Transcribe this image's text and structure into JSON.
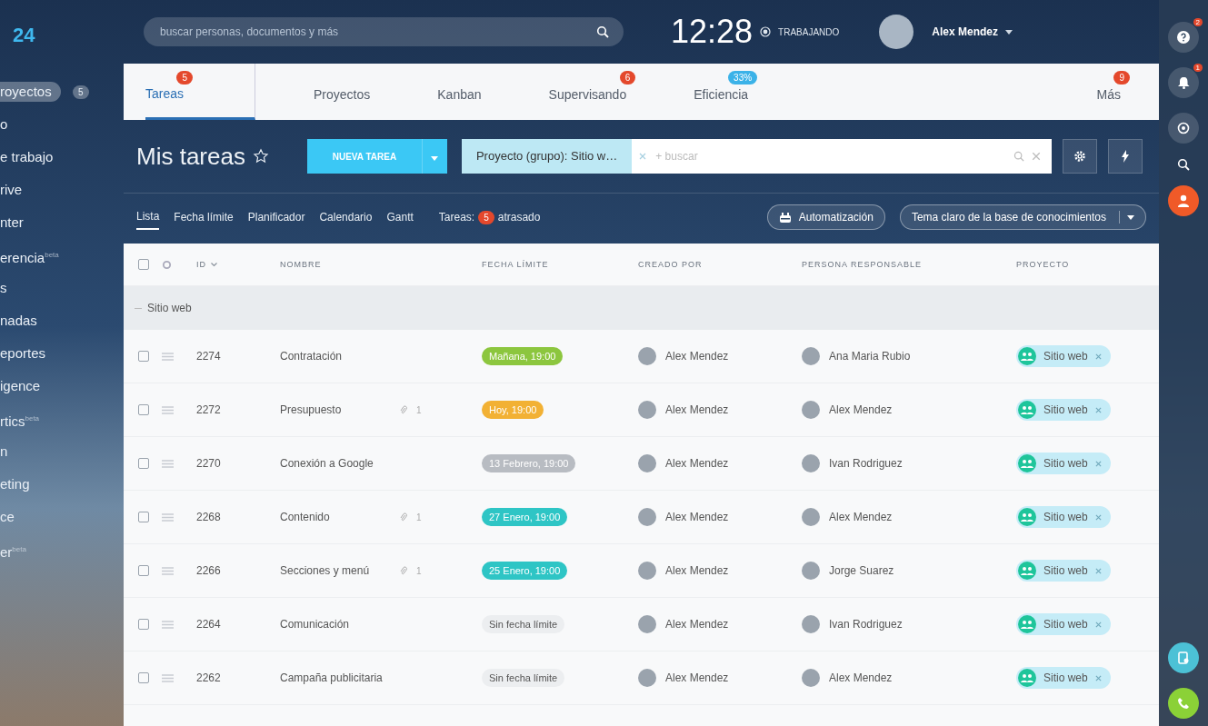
{
  "sidebar": {
    "logo": "24",
    "items": [
      {
        "label": "royectos",
        "badge": "5",
        "selected": true
      },
      {
        "label": "o",
        "selected": false
      },
      {
        "label": "e trabajo",
        "selected": false
      },
      {
        "label": "rive",
        "selected": false
      },
      {
        "label": "nter",
        "selected": false
      },
      {
        "label": "erencia",
        "selected": false,
        "sup": "beta"
      },
      {
        "label": "s",
        "selected": false
      },
      {
        "label": "nadas",
        "selected": false
      },
      {
        "label": "eportes",
        "selected": false
      },
      {
        "label": "igence",
        "selected": false
      },
      {
        "label": "rtics",
        "selected": false,
        "sup": "beta"
      },
      {
        "label": "n",
        "selected": false
      },
      {
        "label": "eting",
        "selected": false
      },
      {
        "label": "ce",
        "selected": false
      },
      {
        "label": "er",
        "selected": false,
        "sup": "beta"
      }
    ]
  },
  "topbar": {
    "search": {
      "placeholder": "buscar personas, documentos y más"
    },
    "time": "12:28",
    "status": "TRABAJANDO",
    "user": "Alex Mendez"
  },
  "tabs": [
    {
      "label": "Tareas",
      "selected": true,
      "badge": {
        "text": "5",
        "color": "#e4482c"
      }
    },
    {
      "label": "Proyectos",
      "selected": false
    },
    {
      "label": "Kanban",
      "selected": false
    },
    {
      "label": "Supervisando",
      "selected": false,
      "badge": {
        "text": "6",
        "color": "#e4482c"
      }
    },
    {
      "label": "Eficiencia",
      "selected": false,
      "badge": {
        "text": "33%",
        "color": "#3bb2e8"
      }
    },
    {
      "label": "Más",
      "selected": false,
      "badge": {
        "text": "9",
        "color": "#e4482c"
      }
    }
  ],
  "toolbar": {
    "title": "Mis tareas",
    "new_button": "NUEVA TAREA",
    "filter_chip": "Proyecto (grupo): Sitio w…",
    "filter_placeholder": "+ buscar"
  },
  "views": [
    {
      "label": "Lista",
      "selected": true
    },
    {
      "label": "Fecha límite",
      "selected": false
    },
    {
      "label": "Planificador",
      "selected": false
    },
    {
      "label": "Calendario",
      "selected": false
    },
    {
      "label": "Gantt",
      "selected": false
    }
  ],
  "counter": {
    "label": "Tareas:",
    "count": "5",
    "suffix": "atrasado"
  },
  "automation_button": "Automatización",
  "theme_button": "Tema claro de la base de conocimientos",
  "table": {
    "columns": [
      "ID",
      "NOMBRE",
      "FECHA LÍMITE",
      "CREADO POR",
      "PERSONA RESPONSABLE",
      "PROYECTO"
    ],
    "all_checked": false,
    "group": "Sitio web",
    "rows": [
      {
        "checked": false,
        "id": "2274",
        "name": "Contratación",
        "due": {
          "text": "Mañana, 19:00",
          "kind": "date",
          "color": "#8cc63e"
        },
        "creator": "Alex Mendez",
        "responsible": "Ana Maria Rubio",
        "project": "Sitio web"
      },
      {
        "checked": false,
        "id": "2272",
        "name": "Presupuesto",
        "comments": "1",
        "due": {
          "text": "Hoy, 19:00",
          "kind": "date",
          "color": "#f2b134"
        },
        "creator": "Alex Mendez",
        "responsible": "Alex Mendez",
        "project": "Sitio web"
      },
      {
        "checked": false,
        "id": "2270",
        "name": "Conexión a Google",
        "due": {
          "text": "13 Febrero, 19:00",
          "kind": "date",
          "color": "#b8bcc2"
        },
        "creator": "Alex Mendez",
        "responsible": "Ivan Rodriguez",
        "project": "Sitio web"
      },
      {
        "checked": false,
        "id": "2268",
        "name": "Contenido",
        "comments": "1",
        "due": {
          "text": "27 Enero, 19:00",
          "kind": "date",
          "color": "#2ec5c5"
        },
        "creator": "Alex Mendez",
        "responsible": "Alex Mendez",
        "project": "Sitio web"
      },
      {
        "checked": false,
        "id": "2266",
        "name": "Secciones y menú",
        "comments": "1",
        "due": {
          "text": "25 Enero, 19:00",
          "kind": "date",
          "color": "#2ec5c5"
        },
        "creator": "Alex Mendez",
        "responsible": "Jorge Suarez",
        "project": "Sitio web"
      },
      {
        "checked": false,
        "id": "2264",
        "name": "Comunicación",
        "due": {
          "text": "Sin fecha límite",
          "kind": "none",
          "color": "#eceef0"
        },
        "creator": "Alex Mendez",
        "responsible": "Ivan Rodriguez",
        "project": "Sitio web"
      },
      {
        "checked": false,
        "id": "2262",
        "name": "Campaña publicitaria",
        "due": {
          "text": "Sin fecha límite",
          "kind": "none",
          "color": "#eceef0"
        },
        "creator": "Alex Mendez",
        "responsible": "Alex Mendez",
        "project": "Sitio web"
      }
    ]
  },
  "rightbar": {
    "help_badge": "2",
    "bell_badge": "1"
  }
}
